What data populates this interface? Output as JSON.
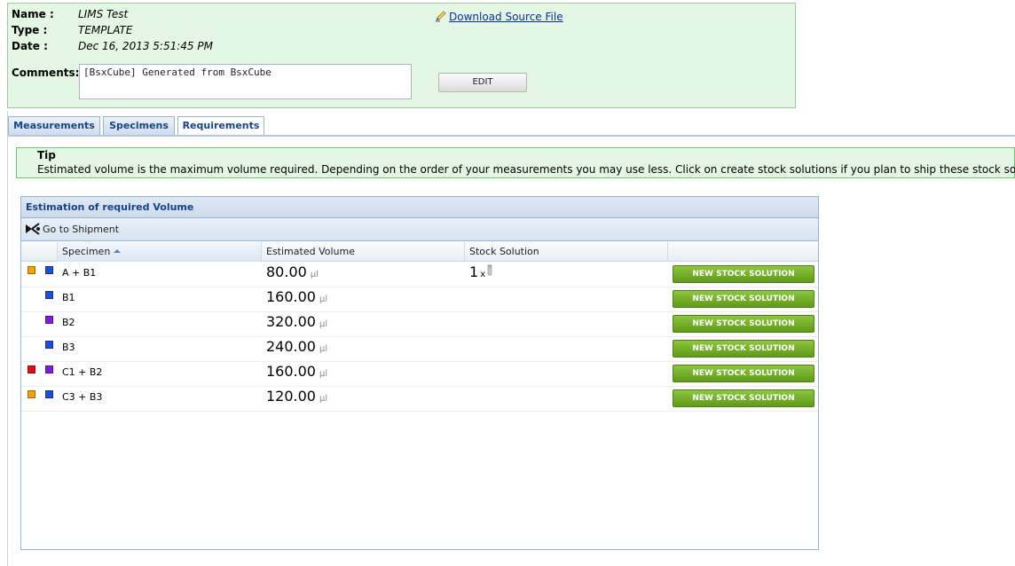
{
  "info": {
    "name_label": "Name :",
    "name_value": "LIMS Test",
    "type_label": "Type :",
    "type_value": "TEMPLATE",
    "date_label": "Date :",
    "date_value": "Dec 16, 2013 5:51:45 PM",
    "comments_label": "Comments:",
    "comments_value": "[BsxCube] Generated from BsxCube",
    "download_label": "Download Source File",
    "edit_label": "EDIT"
  },
  "tabs": [
    {
      "label": "Measurements",
      "active": false
    },
    {
      "label": "Specimens",
      "active": false
    },
    {
      "label": "Requirements",
      "active": true
    }
  ],
  "tip": {
    "title": "Tip",
    "text": "Estimated volume is the maximum volume required. Depending on the order of your measurements you may use less. Click on create stock solutions if you plan to ship these stock solutions"
  },
  "volume_panel": {
    "title": "Estimation of required Volume",
    "toolbar_button": "Go to Shipment",
    "columns": [
      "Specimen",
      "Estimated Volume",
      "Stock Solution",
      ""
    ],
    "unit": "µl",
    "rows": [
      {
        "colors": [
          "#f0a30a",
          "#1f4fd8"
        ],
        "specimen": "A + B1",
        "volume": "80.00",
        "stock_count": "1",
        "stock_x": "x",
        "button": "NEW STOCK SOLUTION"
      },
      {
        "colors": [
          "",
          "#1f4fd8"
        ],
        "specimen": "B1",
        "volume": "160.00",
        "stock_count": "",
        "stock_x": "",
        "button": "NEW STOCK SOLUTION"
      },
      {
        "colors": [
          "",
          "#7b1fd8"
        ],
        "specimen": "B2",
        "volume": "320.00",
        "stock_count": "",
        "stock_x": "",
        "button": "NEW STOCK SOLUTION"
      },
      {
        "colors": [
          "",
          "#1f4fd8"
        ],
        "specimen": "B3",
        "volume": "240.00",
        "stock_count": "",
        "stock_x": "",
        "button": "NEW STOCK SOLUTION"
      },
      {
        "colors": [
          "#e01010",
          "#7b1fd8"
        ],
        "specimen": "C1 + B2",
        "volume": "160.00",
        "stock_count": "",
        "stock_x": "",
        "button": "NEW STOCK SOLUTION"
      },
      {
        "colors": [
          "#f0a30a",
          "#1f4fd8"
        ],
        "specimen": "C3 + B3",
        "volume": "120.00",
        "stock_count": "",
        "stock_x": "",
        "button": "NEW STOCK SOLUTION"
      }
    ]
  },
  "colors": {
    "panel_green": "#e3f7e4",
    "tab_text": "#15428b",
    "button_green": "#6fad22"
  },
  "icons": {
    "download": "pencil-icon",
    "shipment": "shipment-icon",
    "stock": "tube-icon",
    "sort": "sort-asc-icon"
  }
}
